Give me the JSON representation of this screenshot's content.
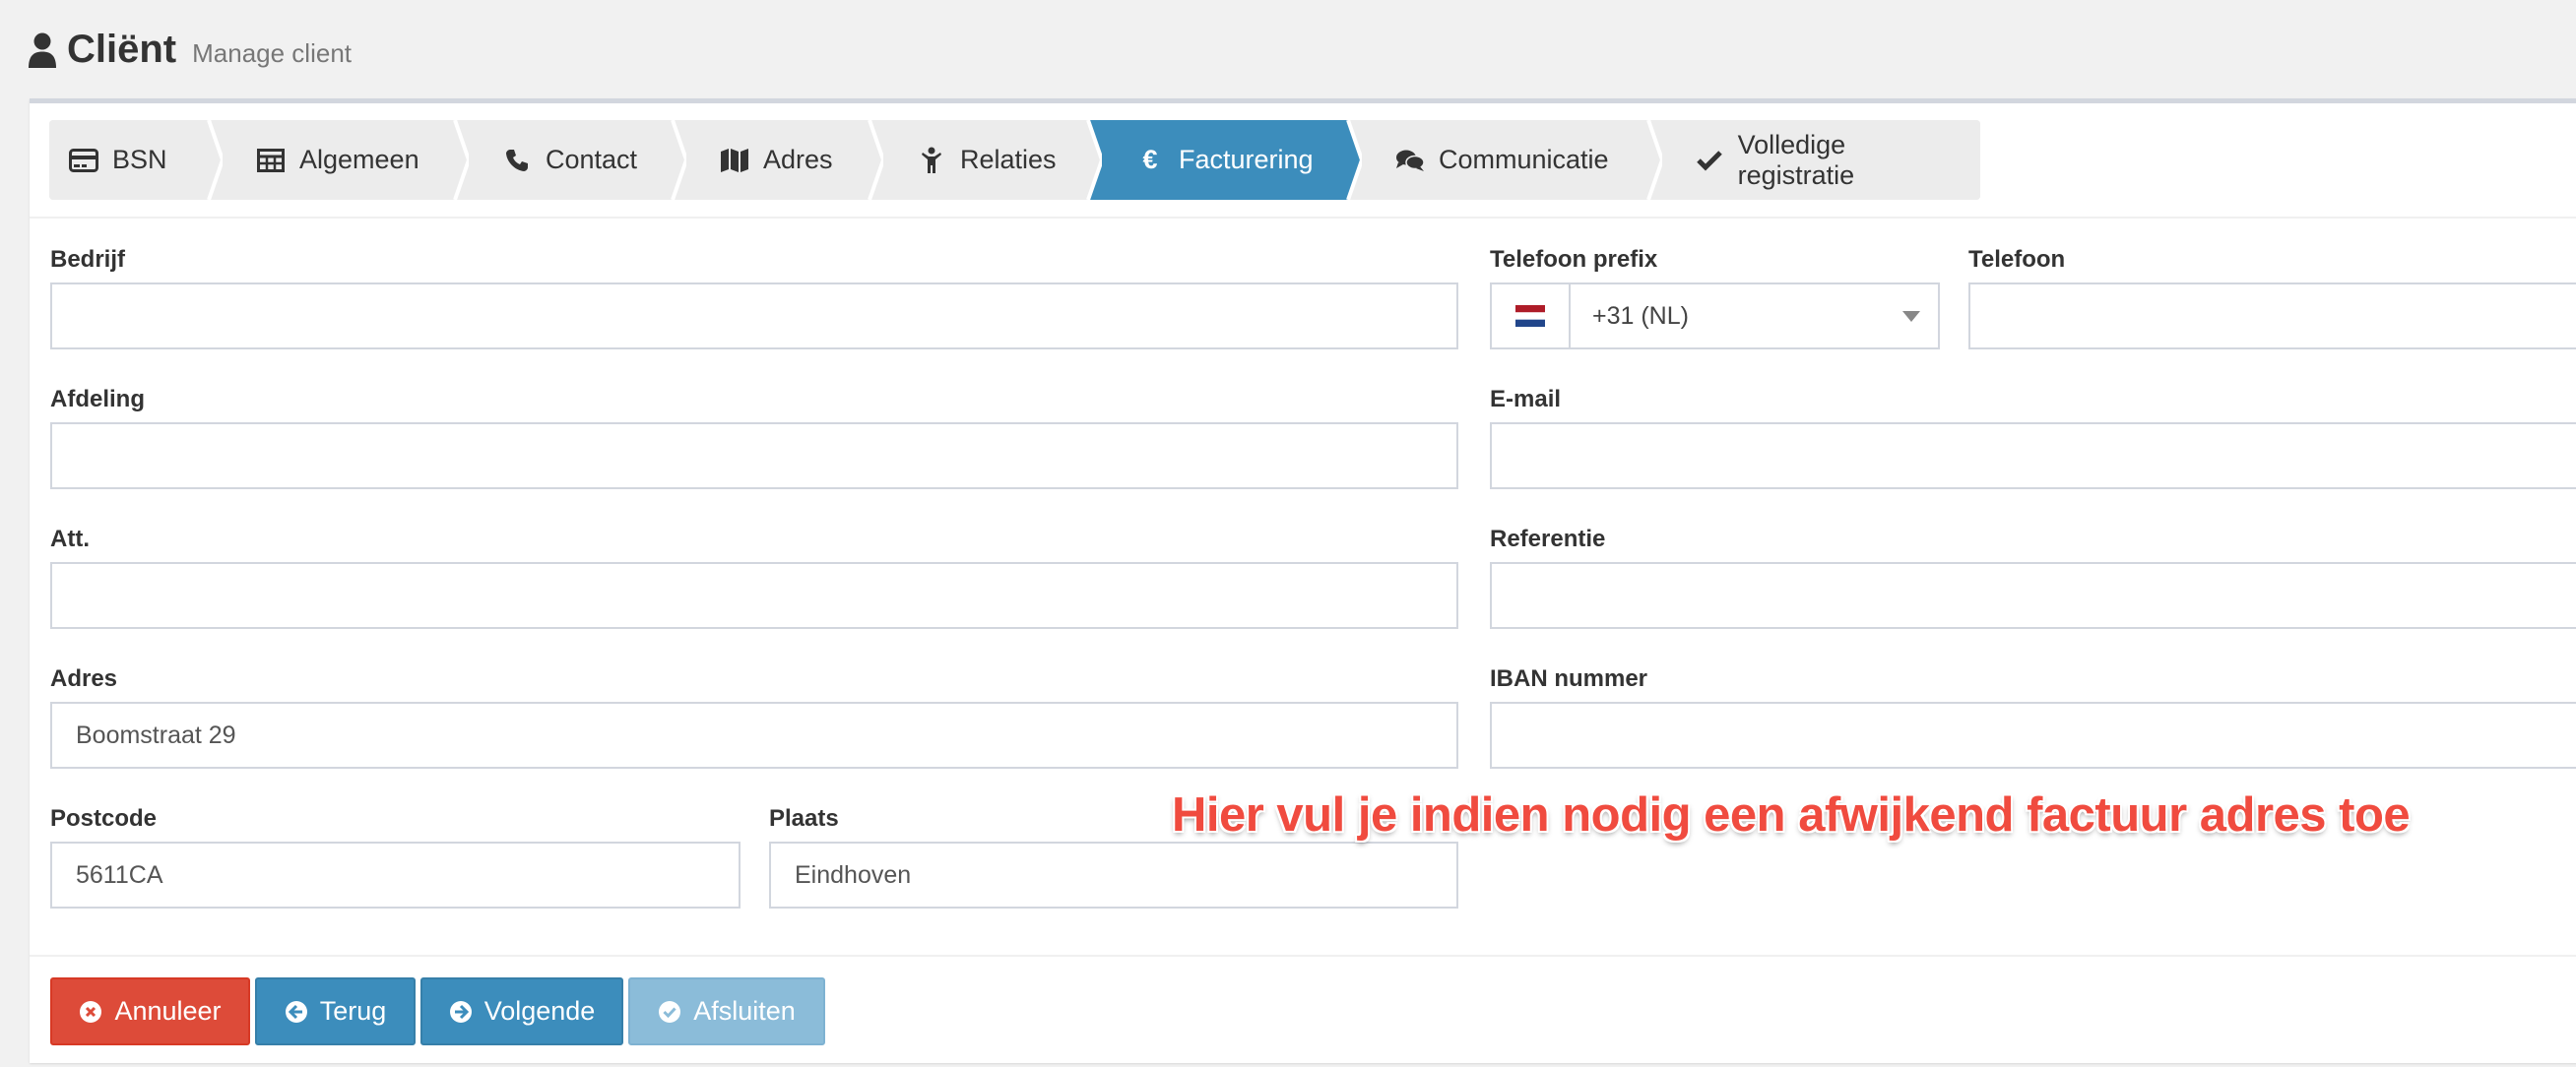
{
  "header": {
    "icon": "user-icon",
    "title": "Cliënt",
    "subtitle": "Manage client"
  },
  "wizard": {
    "steps": [
      {
        "label": "BSN",
        "icon": "credit-card-icon"
      },
      {
        "label": "Algemeen",
        "icon": "table-icon"
      },
      {
        "label": "Contact",
        "icon": "phone-icon"
      },
      {
        "label": "Adres",
        "icon": "map-icon"
      },
      {
        "label": "Relaties",
        "icon": "child-icon"
      },
      {
        "label": "Facturering",
        "icon": "euro-icon",
        "active": true
      },
      {
        "label": "Communicatie",
        "icon": "comments-icon"
      },
      {
        "label": "Volledige registratie",
        "icon": "check-icon"
      }
    ],
    "active_color": "#3c8dbc"
  },
  "form": {
    "bedrijf": {
      "label": "Bedrijf",
      "value": ""
    },
    "afdeling": {
      "label": "Afdeling",
      "value": ""
    },
    "att": {
      "label": "Att.",
      "value": ""
    },
    "adres": {
      "label": "Adres",
      "value": "Boomstraat 29"
    },
    "postcode": {
      "label": "Postcode",
      "value": "5611CA"
    },
    "plaats": {
      "label": "Plaats",
      "value": "Eindhoven"
    },
    "telefoon_prefix": {
      "label": "Telefoon prefix",
      "value": "+31 (NL)",
      "flag": "nl-flag-icon"
    },
    "telefoon": {
      "label": "Telefoon",
      "value": ""
    },
    "email": {
      "label": "E-mail",
      "value": ""
    },
    "referentie": {
      "label": "Referentie",
      "value": ""
    },
    "iban": {
      "label": "IBAN nummer",
      "value": ""
    }
  },
  "annotation": "Hier vul je indien nodig een afwijkend factuur adres toe",
  "buttons": {
    "cancel": {
      "label": "Annuleer",
      "icon": "times-circle-icon",
      "color": "#dd4b39"
    },
    "back": {
      "label": "Terug",
      "icon": "arrow-circle-left-icon",
      "color": "#3c8dbc"
    },
    "next": {
      "label": "Volgende",
      "icon": "arrow-circle-right-icon",
      "color": "#3c8dbc"
    },
    "finish": {
      "label": "Afsluiten",
      "icon": "check-circle-icon",
      "color": "#8bbcd9",
      "disabled": true
    }
  }
}
